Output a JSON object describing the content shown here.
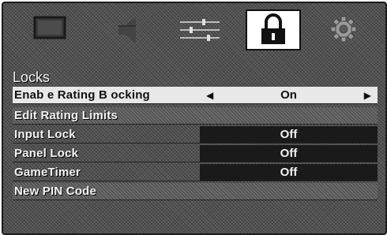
{
  "tabs": [
    {
      "icon": "picture-icon",
      "selected": false
    },
    {
      "icon": "speaker-icon",
      "selected": false
    },
    {
      "icon": "sliders-icon",
      "selected": false
    },
    {
      "icon": "lock-icon",
      "selected": true
    },
    {
      "icon": "gear-icon",
      "selected": false
    }
  ],
  "menu": {
    "title": "Locks",
    "rows": [
      {
        "label": "Enab e Rating B ocking",
        "value": "On",
        "selected": true
      },
      {
        "label": "Edit Rating Limits",
        "value": ""
      },
      {
        "label": "Input Lock",
        "value": "Off"
      },
      {
        "label": "Panel Lock",
        "value": "Off"
      },
      {
        "label": "GameTimer",
        "value": "Off"
      },
      {
        "label": "New PIN Code",
        "value": ""
      }
    ],
    "left_arrow": "◀",
    "right_arrow": "▶"
  }
}
